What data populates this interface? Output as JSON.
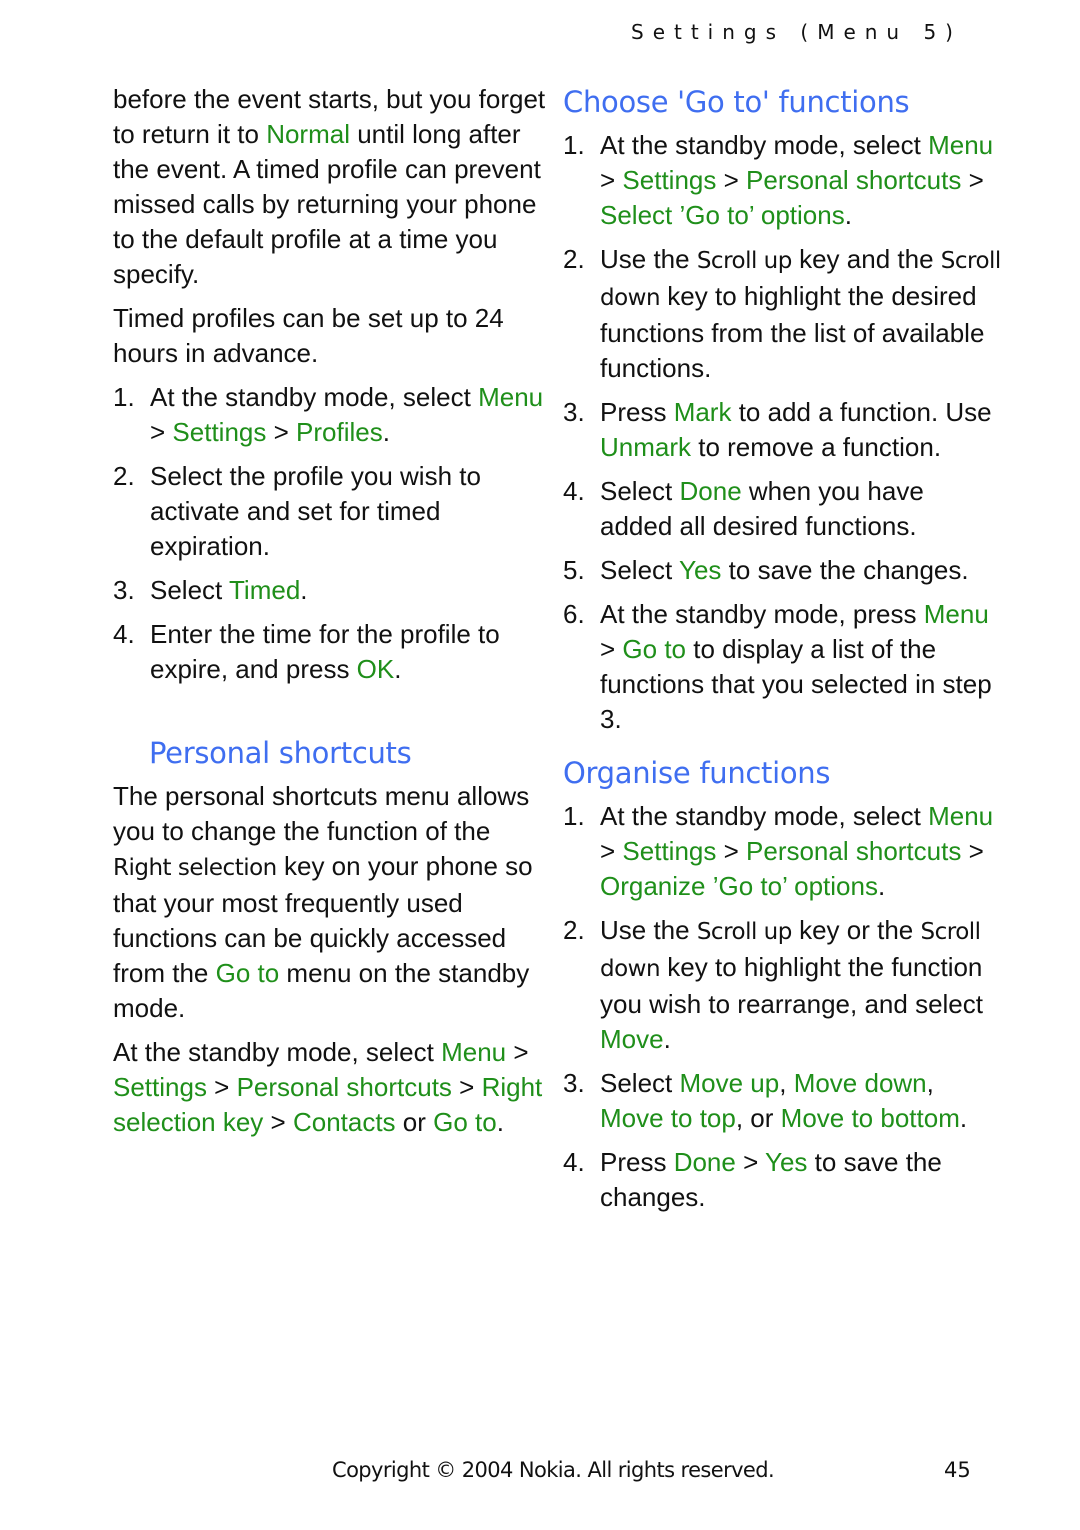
{
  "header": {
    "running_title": "Settings (Menu 5)"
  },
  "left": {
    "intro_p1": [
      "before the event starts, but you forget to return it to ",
      "Normal",
      " until long after the event. A timed profile can prevent missed calls by returning your phone to the default profile at a time you specify."
    ],
    "intro_p2": "Timed profiles can be set up to 24 hours in advance.",
    "timed_steps": [
      {
        "num": "1.",
        "parts": [
          [
            "t",
            "At the standby mode, select "
          ],
          [
            "g",
            "Menu"
          ],
          [
            "t",
            " > "
          ],
          [
            "g",
            "Settings"
          ],
          [
            "t",
            " > "
          ],
          [
            "g",
            "Profiles"
          ],
          [
            "t",
            "."
          ]
        ]
      },
      {
        "num": "2.",
        "parts": [
          [
            "t",
            "Select the profile you wish to activate and set for timed expiration."
          ]
        ]
      },
      {
        "num": "3.",
        "parts": [
          [
            "t",
            "Select "
          ],
          [
            "g",
            "Timed"
          ],
          [
            "t",
            "."
          ]
        ]
      },
      {
        "num": "4.",
        "parts": [
          [
            "t",
            "Enter the time for the profile to expire, and press "
          ],
          [
            "g",
            "OK"
          ],
          [
            "t",
            "."
          ]
        ]
      }
    ],
    "personal_heading": "Personal shortcuts",
    "personal_p1": [
      [
        "t",
        "The personal shortcuts menu allows you to change the function of the "
      ],
      [
        "k",
        "Right selection"
      ],
      [
        "t",
        " key on your phone so that your most frequently used functions can be quickly accessed from the "
      ],
      [
        "g",
        "Go to"
      ],
      [
        "t",
        " menu on the standby mode."
      ]
    ],
    "personal_p2": [
      [
        "t",
        "At the standby mode, select "
      ],
      [
        "g",
        "Menu"
      ],
      [
        "t",
        " > "
      ],
      [
        "g",
        "Settings"
      ],
      [
        "t",
        " > "
      ],
      [
        "g",
        "Personal shortcuts"
      ],
      [
        "t",
        " > "
      ],
      [
        "g",
        "Right selection key"
      ],
      [
        "t",
        " > "
      ],
      [
        "g",
        "Contacts"
      ],
      [
        "t",
        " or "
      ],
      [
        "g",
        "Go to"
      ],
      [
        "t",
        "."
      ]
    ]
  },
  "right": {
    "choose_heading": "Choose 'Go to' functions",
    "choose_steps": [
      {
        "num": "1.",
        "parts": [
          [
            "t",
            "At the standby mode, select "
          ],
          [
            "g",
            "Menu"
          ],
          [
            "t",
            " > "
          ],
          [
            "g",
            "Settings"
          ],
          [
            "t",
            " > "
          ],
          [
            "g",
            "Personal shortcuts"
          ],
          [
            "t",
            " > "
          ],
          [
            "g",
            "Select ’Go to’ options"
          ],
          [
            "t",
            "."
          ]
        ]
      },
      {
        "num": "2.",
        "parts": [
          [
            "t",
            "Use the "
          ],
          [
            "k",
            "Scroll up"
          ],
          [
            "t",
            " key and the "
          ],
          [
            "k",
            "Scroll down"
          ],
          [
            "t",
            " key to highlight the desired functions from the list of available functions."
          ]
        ]
      },
      {
        "num": "3.",
        "parts": [
          [
            "t",
            "Press "
          ],
          [
            "g",
            "Mark"
          ],
          [
            "t",
            " to add a function. Use "
          ],
          [
            "g",
            "Unmark"
          ],
          [
            "t",
            " to remove a function."
          ]
        ]
      },
      {
        "num": "4.",
        "parts": [
          [
            "t",
            "Select "
          ],
          [
            "g",
            "Done"
          ],
          [
            "t",
            " when you have added all desired functions."
          ]
        ]
      },
      {
        "num": "5.",
        "parts": [
          [
            "t",
            "Select "
          ],
          [
            "g",
            "Yes"
          ],
          [
            "t",
            " to save the changes."
          ]
        ]
      },
      {
        "num": "6.",
        "parts": [
          [
            "t",
            "At the standby mode, press "
          ],
          [
            "g",
            "Menu"
          ],
          [
            "t",
            " > "
          ],
          [
            "g",
            "Go to"
          ],
          [
            "t",
            " to display a list of the functions that you selected in step 3."
          ]
        ]
      }
    ],
    "organise_heading": "Organise functions",
    "organise_steps": [
      {
        "num": "1.",
        "parts": [
          [
            "t",
            "At the standby mode, select "
          ],
          [
            "g",
            "Menu"
          ],
          [
            "t",
            " > "
          ],
          [
            "g",
            "Settings"
          ],
          [
            "t",
            " > "
          ],
          [
            "g",
            "Personal shortcuts"
          ],
          [
            "t",
            " > "
          ],
          [
            "g",
            "Organize ’Go to’ options"
          ],
          [
            "t",
            "."
          ]
        ]
      },
      {
        "num": "2.",
        "parts": [
          [
            "t",
            "Use the "
          ],
          [
            "k",
            "Scroll up"
          ],
          [
            "t",
            " key or the "
          ],
          [
            "k",
            "Scroll down"
          ],
          [
            "t",
            " key to highlight the function you wish to rearrange, and select "
          ],
          [
            "g",
            "Move"
          ],
          [
            "t",
            "."
          ]
        ]
      },
      {
        "num": "3.",
        "parts": [
          [
            "t",
            "Select "
          ],
          [
            "g",
            "Move up"
          ],
          [
            "t",
            ", "
          ],
          [
            "g",
            "Move down"
          ],
          [
            "t",
            ", "
          ],
          [
            "g",
            "Move to top"
          ],
          [
            "t",
            ", or "
          ],
          [
            "g",
            "Move to bottom"
          ],
          [
            "t",
            "."
          ]
        ]
      },
      {
        "num": "4.",
        "parts": [
          [
            "t",
            "Press "
          ],
          [
            "g",
            "Done"
          ],
          [
            "t",
            " > "
          ],
          [
            "g",
            "Yes"
          ],
          [
            "t",
            " to save the changes."
          ]
        ]
      }
    ]
  },
  "footer": {
    "copyright": "Copyright © 2004 Nokia. All rights reserved.",
    "page_number": "45"
  },
  "colors": {
    "heading_blue": "#3f6ef0",
    "ui_green": "#1f8f1a",
    "text": "#111111"
  }
}
